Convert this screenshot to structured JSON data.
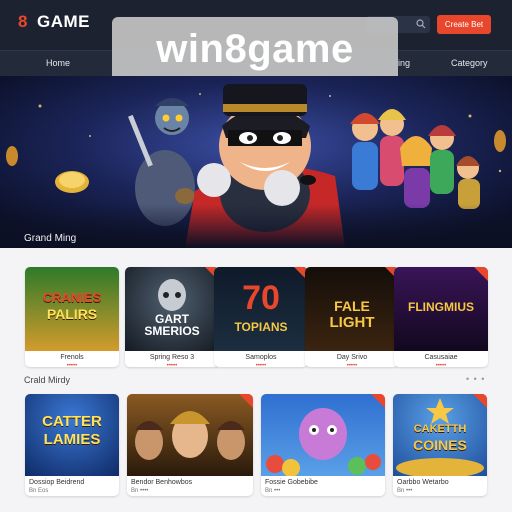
{
  "header": {
    "logo_mark": "8",
    "logo_text": "GAME",
    "cta_label": "Create Bet",
    "nav": [
      "Home",
      "ing",
      "Category"
    ]
  },
  "watermark": "win8game",
  "hero": {
    "caption": "Grand Ming"
  },
  "sections": [
    {
      "title": "",
      "cards": [
        {
          "art_title": [
            "CRANIES",
            "PALIRS"
          ],
          "label": "Frenols",
          "sub": "•••••"
        },
        {
          "art_title": [
            "GART",
            "SMERIOS"
          ],
          "label": "Spring Reso 3",
          "sub": "•••••"
        },
        {
          "art_title": [
            "70",
            "TOPIANS"
          ],
          "label": "Samoplos",
          "sub": "•••••"
        },
        {
          "art_title": [
            "FALE",
            "LIGHT"
          ],
          "label": "Day Srivo",
          "sub": "•••••"
        },
        {
          "art_title": [
            "FLINGMIUS",
            ""
          ],
          "label": "Casusaiae",
          "sub": "•••••"
        }
      ]
    },
    {
      "title": "Crald Mirdy",
      "dots": "• • •",
      "cards": [
        {
          "art_title": [
            "CATTER",
            "LAMIES"
          ],
          "label": "Dossiop Beidrend",
          "sub": "Bn          Eos"
        },
        {
          "art_title": [
            "",
            ""
          ],
          "label": "Bendor Benhowbos",
          "sub": "Bn        ••••"
        },
        {
          "art_title": [
            "",
            ""
          ],
          "label": "Fossie Gobebibe",
          "sub": "Bn      •••"
        },
        {
          "art_title": [
            "CAKETTH",
            "COINES"
          ],
          "label": "Oarbbo Wetarbo",
          "sub": "Bn      •••"
        }
      ]
    }
  ],
  "colors": {
    "accent": "#e8472c",
    "header_bg": "#1c2230",
    "nav_bg": "#232a3a",
    "page_bg": "#f4f4f6"
  }
}
